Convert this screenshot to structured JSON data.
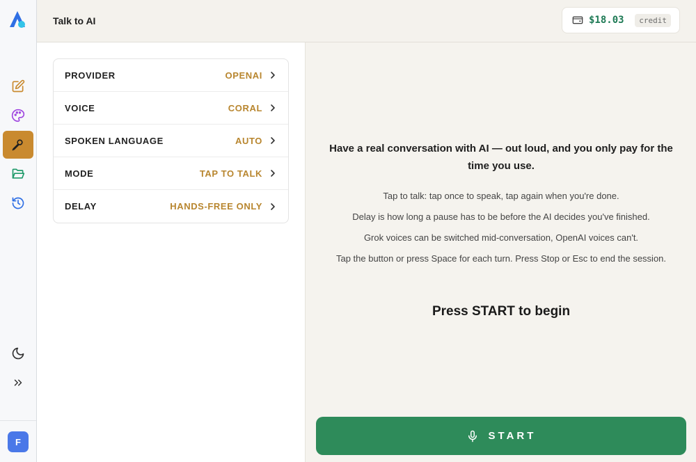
{
  "header": {
    "title": "Talk to AI",
    "credit_amount": "$18.03",
    "credit_label": "credit"
  },
  "sidebar": {
    "items": [
      {
        "name": "edit-icon",
        "active": false
      },
      {
        "name": "palette-icon",
        "active": false
      },
      {
        "name": "microphone-pen-icon",
        "active": true
      },
      {
        "name": "folder-open-icon",
        "active": false
      },
      {
        "name": "history-icon",
        "active": false
      }
    ],
    "avatar_initial": "F"
  },
  "settings": [
    {
      "label": "PROVIDER",
      "value": "OPENAI"
    },
    {
      "label": "VOICE",
      "value": "CORAL"
    },
    {
      "label": "SPOKEN LANGUAGE",
      "value": "AUTO"
    },
    {
      "label": "MODE",
      "value": "TAP TO TALK"
    },
    {
      "label": "DELAY",
      "value": "HANDS-FREE ONLY"
    }
  ],
  "main": {
    "intro": "Have a real conversation with AI — out loud, and you only pay for the time you use.",
    "info": [
      "Tap to talk: tap once to speak, tap again when you're done.",
      "Delay is how long a pause has to be before the AI decides you've finished.",
      "Grok voices can be switched mid-conversation, OpenAI voices can't.",
      "Tap the button or press Space for each turn. Press Stop or Esc to end the session."
    ],
    "prompt": "Press START to begin",
    "start_label": "START"
  },
  "colors": {
    "accent": "#c98a2f",
    "value_text": "#b8862f",
    "start_button": "#2e8b5a",
    "credit_green": "#1e7a55",
    "avatar": "#4a78e8"
  }
}
